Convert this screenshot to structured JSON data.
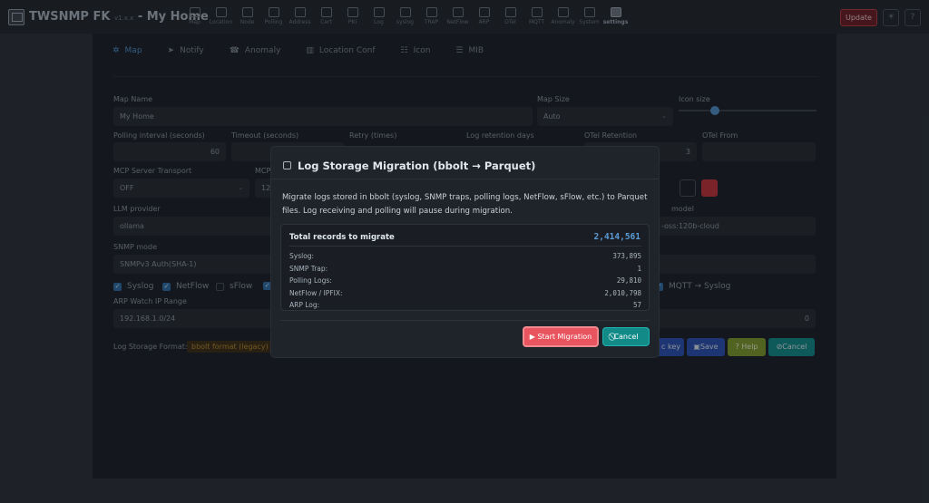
{
  "app": {
    "name": "TWSNMP FK",
    "version": "v1.x.x",
    "subtitle": "- My Home",
    "update_label": "Update",
    "theme_icon": "sun-icon",
    "help_label": "?"
  },
  "nav": [
    {
      "label": "Map",
      "icon": "map-icon"
    },
    {
      "label": "Location",
      "icon": "location-icon"
    },
    {
      "label": "Node",
      "icon": "node-icon"
    },
    {
      "label": "Polling",
      "icon": "polling-icon"
    },
    {
      "label": "Address",
      "icon": "address-icon"
    },
    {
      "label": "Cert",
      "icon": "cert-icon"
    },
    {
      "label": "PKI",
      "icon": "pki-icon"
    },
    {
      "label": "Log",
      "icon": "log-icon"
    },
    {
      "label": "syslog",
      "icon": "syslog-icon"
    },
    {
      "label": "TRAP",
      "icon": "trap-icon"
    },
    {
      "label": "NetFlow",
      "icon": "netflow-icon"
    },
    {
      "label": "ARP",
      "icon": "arp-icon"
    },
    {
      "label": "OTel",
      "icon": "otel-icon"
    },
    {
      "label": "MQTT",
      "icon": "mqtt-icon"
    },
    {
      "label": "Anomaly",
      "icon": "anomaly-icon"
    },
    {
      "label": "System",
      "icon": "system-icon"
    },
    {
      "label": "settings",
      "icon": "gear-icon",
      "active": true
    }
  ],
  "tabs": [
    {
      "label": "Map",
      "icon": "✲",
      "active": true
    },
    {
      "label": "Notify",
      "icon": "➤"
    },
    {
      "label": "Anomaly",
      "icon": "☎"
    },
    {
      "label": "Location Conf",
      "icon": "▥"
    },
    {
      "label": "Icon",
      "icon": "☷"
    },
    {
      "label": "MIB",
      "icon": "☰"
    }
  ],
  "form": {
    "map_name_label": "Map Name",
    "map_name_value": "My Home",
    "map_size_label": "Map Size",
    "map_size_value": "Auto",
    "icon_size_label": "Icon size",
    "polling_interval_label": "Polling interval (seconds)",
    "polling_interval_value": "60",
    "timeout_label": "Timeout (seconds)",
    "retry_label": "Retry (times)",
    "log_retention_label": "Log retention days",
    "otel_retention_label": "OTel Retention",
    "otel_retention_value": "3",
    "otel_from_label": "OTel From",
    "mcp_transport_label": "MCP Server Transport",
    "mcp_transport_value": "OFF",
    "mcp_endpoint_label": "MCP",
    "mcp_endpoint_value": "127",
    "llm_provider_label": "LLM provider",
    "llm_provider_value": "ollama",
    "llm_model_label": "model",
    "llm_model_value": "-oss:120b-cloud",
    "snmp_mode_label": "SNMP mode",
    "snmp_mode_value": "SNMPv3 Auth(SHA-1)",
    "arp_range_label": "ARP Watch IP Range",
    "arp_range_value": "192.168.1.0/24",
    "arp_extra_value": "0",
    "log_storage_label": "Log Storage Format:",
    "log_storage_value": "bbolt format (legacy)"
  },
  "checks": {
    "syslog": "Syslog",
    "netflow": "NetFlow",
    "sflow": "sFlow",
    "mqtt_syslog": "MQTT → Syslog"
  },
  "actions": {
    "key_label": "c key",
    "save_label": "Save",
    "help_label": "Help",
    "cancel_label": "Cancel"
  },
  "modal": {
    "title": "Log Storage Migration (bbolt → Parquet)",
    "description": "Migrate logs stored in bbolt (syslog, SNMP traps, polling logs, NetFlow, sFlow, etc.) to Parquet files. Log receiving and polling will pause during migration.",
    "total_label": "Total records to migrate",
    "total_value": "2,414,561",
    "rows": [
      {
        "label": "Syslog:",
        "value": "373,895"
      },
      {
        "label": "SNMP Trap:",
        "value": "1"
      },
      {
        "label": "Polling Logs:",
        "value": "29,810"
      },
      {
        "label": "NetFlow / IPFIX:",
        "value": "2,010,798"
      },
      {
        "label": "ARP Log:",
        "value": "57"
      }
    ],
    "start_label": "▶ Start Migration",
    "cancel_label": "⃠Cancel"
  },
  "colors": {
    "accent": "#4f8fc8",
    "danger": "#e8555e",
    "teal": "#128a88",
    "total_value": "#5b9bd5"
  }
}
